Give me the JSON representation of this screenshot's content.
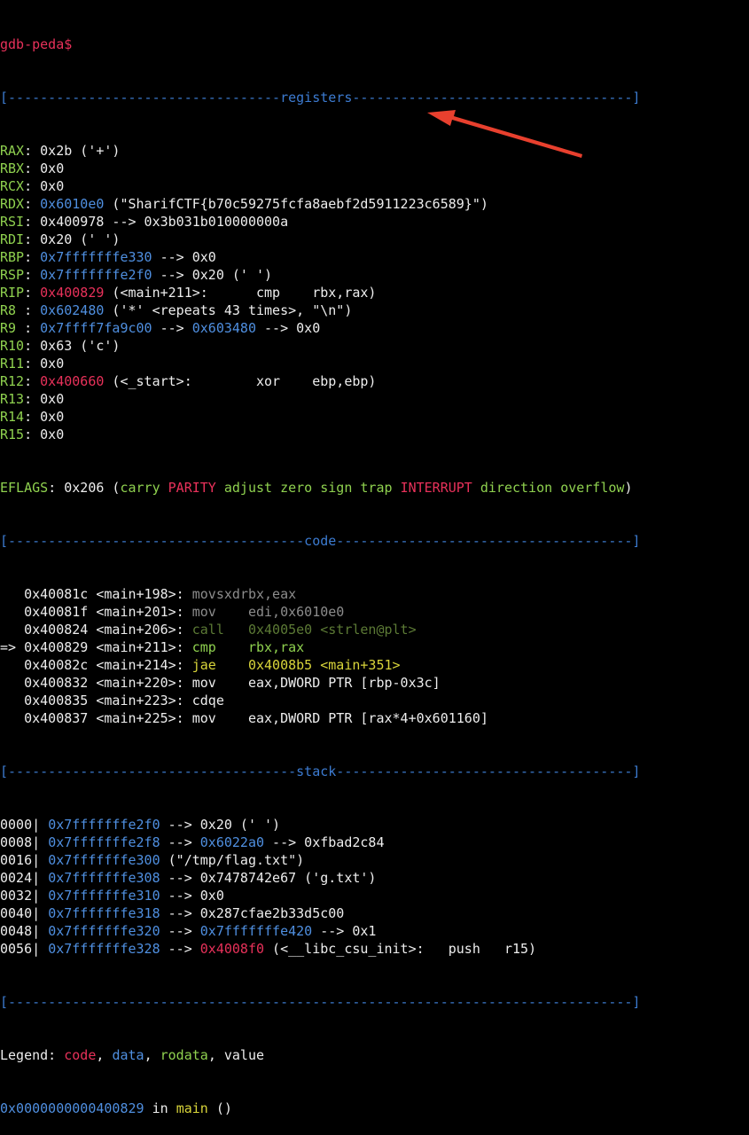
{
  "prompt": "gdb-peda$",
  "sections": {
    "registers": "[----------------------------------registers-----------------------------------]",
    "code": "[-------------------------------------code-------------------------------------]",
    "stack": "[------------------------------------stack-------------------------------------]",
    "end": "[------------------------------------------------------------------------------]"
  },
  "registers": [
    {
      "name": "RAX",
      "sep": ": ",
      "parts": [
        {
          "t": "0x2b ('+')",
          "c": ""
        }
      ]
    },
    {
      "name": "RBX",
      "sep": ": ",
      "parts": [
        {
          "t": "0x0",
          "c": ""
        }
      ]
    },
    {
      "name": "RCX",
      "sep": ": ",
      "parts": [
        {
          "t": "0x0",
          "c": ""
        }
      ]
    },
    {
      "name": "RDX",
      "sep": ": ",
      "parts": [
        {
          "t": "0x6010e0",
          "c": "blue"
        },
        {
          "t": " (\"SharifCTF{b70c59275fcfa8aebf2d5911223c6589}\")",
          "c": ""
        }
      ]
    },
    {
      "name": "RSI",
      "sep": ": ",
      "parts": [
        {
          "t": "0x400978 --> 0x3b031b010000000a",
          "c": ""
        }
      ]
    },
    {
      "name": "RDI",
      "sep": ": ",
      "parts": [
        {
          "t": "0x20 (' ')",
          "c": ""
        }
      ]
    },
    {
      "name": "RBP",
      "sep": ": ",
      "parts": [
        {
          "t": "0x7fffffffe330",
          "c": "blue"
        },
        {
          "t": " --> 0x0",
          "c": ""
        }
      ]
    },
    {
      "name": "RSP",
      "sep": ": ",
      "parts": [
        {
          "t": "0x7fffffffe2f0",
          "c": "blue"
        },
        {
          "t": " --> 0x20 (' ')",
          "c": ""
        }
      ]
    },
    {
      "name": "RIP",
      "sep": ": ",
      "parts": [
        {
          "t": "0x400829",
          "c": "red"
        },
        {
          "t": " (<main+211>:      cmp    rbx,rax)",
          "c": ""
        }
      ]
    },
    {
      "name": "R8 ",
      "sep": ": ",
      "parts": [
        {
          "t": "0x602480",
          "c": "blue"
        },
        {
          "t": " ('*' <repeats 43 times>, \"\\n\")",
          "c": ""
        }
      ]
    },
    {
      "name": "R9 ",
      "sep": ": ",
      "parts": [
        {
          "t": "0x7ffff7fa9c00",
          "c": "blue"
        },
        {
          "t": " --> ",
          "c": ""
        },
        {
          "t": "0x603480",
          "c": "blue"
        },
        {
          "t": " --> 0x0",
          "c": ""
        }
      ]
    },
    {
      "name": "R10",
      "sep": ": ",
      "parts": [
        {
          "t": "0x63 ('c')",
          "c": ""
        }
      ]
    },
    {
      "name": "R11",
      "sep": ": ",
      "parts": [
        {
          "t": "0x0",
          "c": ""
        }
      ]
    },
    {
      "name": "R12",
      "sep": ": ",
      "parts": [
        {
          "t": "0x400660",
          "c": "red"
        },
        {
          "t": " (<_start>:        xor    ebp,ebp)",
          "c": ""
        }
      ]
    },
    {
      "name": "R13",
      "sep": ": ",
      "parts": [
        {
          "t": "0x0",
          "c": ""
        }
      ]
    },
    {
      "name": "R14",
      "sep": ": ",
      "parts": [
        {
          "t": "0x0",
          "c": ""
        }
      ]
    },
    {
      "name": "R15",
      "sep": ": ",
      "parts": [
        {
          "t": "0x0",
          "c": ""
        }
      ]
    }
  ],
  "eflags": {
    "name": "EFLAGS",
    "value": ": 0x206 (",
    "flags": [
      {
        "t": "carry",
        "c": "green"
      },
      {
        "t": "PARITY",
        "c": "red"
      },
      {
        "t": "adjust",
        "c": "green"
      },
      {
        "t": "zero",
        "c": "green"
      },
      {
        "t": "sign",
        "c": "green"
      },
      {
        "t": "trap",
        "c": "green"
      },
      {
        "t": "INTERRUPT",
        "c": "red"
      },
      {
        "t": "direction",
        "c": "green"
      },
      {
        "t": "overflow",
        "c": "green"
      }
    ],
    "close": ")"
  },
  "code": [
    {
      "marker": "   ",
      "addr": "0x40081c <main+198>:",
      "op": "movsxd",
      "args": "rbx,eax",
      "c": "dim",
      "target": "",
      "tc": ""
    },
    {
      "marker": "   ",
      "addr": "0x40081f <main+201>:",
      "op": "mov   ",
      "args": " edi,0x6010e0",
      "c": "dim",
      "target": "",
      "tc": ""
    },
    {
      "marker": "   ",
      "addr": "0x400824 <main+206>:",
      "op": "call  ",
      "args": " 0x4005e0 <strlen@plt>",
      "c": "dimgreen",
      "target": "",
      "tc": ""
    },
    {
      "marker": "=> ",
      "addr": "0x400829 <main+211>:",
      "op": "cmp   ",
      "args": " rbx,rax",
      "c": "green",
      "target": "",
      "tc": ""
    },
    {
      "marker": "   ",
      "addr": "0x40082c <main+214>:",
      "op": "jae   ",
      "args": " 0x4008b5 <main+351>",
      "c": "yellow",
      "target": "",
      "tc": ""
    },
    {
      "marker": "   ",
      "addr": "0x400832 <main+220>:",
      "op": "mov   ",
      "args": " eax,DWORD PTR [rbp-0x3c]",
      "c": "",
      "target": "",
      "tc": ""
    },
    {
      "marker": "   ",
      "addr": "0x400835 <main+223>:",
      "op": "cdqe",
      "args": "",
      "c": "",
      "target": "",
      "tc": ""
    },
    {
      "marker": "   ",
      "addr": "0x400837 <main+225>:",
      "op": "mov   ",
      "args": " eax,DWORD PTR [rax*4+0x601160]",
      "c": "",
      "target": "",
      "tc": ""
    }
  ],
  "stack": [
    {
      "off": "0000|",
      "parts": [
        {
          "t": " ",
          "c": ""
        },
        {
          "t": "0x7fffffffe2f0",
          "c": "blue"
        },
        {
          "t": " --> 0x20 (' ')",
          "c": ""
        }
      ]
    },
    {
      "off": "0008|",
      "parts": [
        {
          "t": " ",
          "c": ""
        },
        {
          "t": "0x7fffffffe2f8",
          "c": "blue"
        },
        {
          "t": " --> ",
          "c": ""
        },
        {
          "t": "0x6022a0",
          "c": "blue"
        },
        {
          "t": " --> 0xfbad2c84",
          "c": ""
        }
      ]
    },
    {
      "off": "0016|",
      "parts": [
        {
          "t": " ",
          "c": ""
        },
        {
          "t": "0x7fffffffe300",
          "c": "blue"
        },
        {
          "t": " (\"/tmp/flag.txt\")",
          "c": ""
        }
      ]
    },
    {
      "off": "0024|",
      "parts": [
        {
          "t": " ",
          "c": ""
        },
        {
          "t": "0x7fffffffe308",
          "c": "blue"
        },
        {
          "t": " --> 0x7478742e67 ('g.txt')",
          "c": ""
        }
      ]
    },
    {
      "off": "0032|",
      "parts": [
        {
          "t": " ",
          "c": ""
        },
        {
          "t": "0x7fffffffe310",
          "c": "blue"
        },
        {
          "t": " --> 0x0",
          "c": ""
        }
      ]
    },
    {
      "off": "0040|",
      "parts": [
        {
          "t": " ",
          "c": ""
        },
        {
          "t": "0x7fffffffe318",
          "c": "blue"
        },
        {
          "t": " --> 0x287cfae2b33d5c00",
          "c": ""
        }
      ]
    },
    {
      "off": "0048|",
      "parts": [
        {
          "t": " ",
          "c": ""
        },
        {
          "t": "0x7fffffffe320",
          "c": "blue"
        },
        {
          "t": " --> ",
          "c": ""
        },
        {
          "t": "0x7fffffffe420",
          "c": "blue"
        },
        {
          "t": " --> 0x1",
          "c": ""
        }
      ]
    },
    {
      "off": "0056|",
      "parts": [
        {
          "t": " ",
          "c": ""
        },
        {
          "t": "0x7fffffffe328",
          "c": "blue"
        },
        {
          "t": " --> ",
          "c": ""
        },
        {
          "t": "0x4008f0",
          "c": "red"
        },
        {
          "t": " (<__libc_csu_init>:   push   r15)",
          "c": ""
        }
      ]
    }
  ],
  "legend": {
    "label": "Legend: ",
    "items": [
      {
        "t": "code",
        "c": "red"
      },
      {
        "t": "data",
        "c": "blue"
      },
      {
        "t": "rodata",
        "c": "green"
      },
      {
        "t": "value",
        "c": ""
      }
    ]
  },
  "location": {
    "addr": "0x0000000000400829",
    "in": " in ",
    "func": "main",
    "rest": " ()"
  },
  "annotation": {
    "color": "#e8402e"
  }
}
